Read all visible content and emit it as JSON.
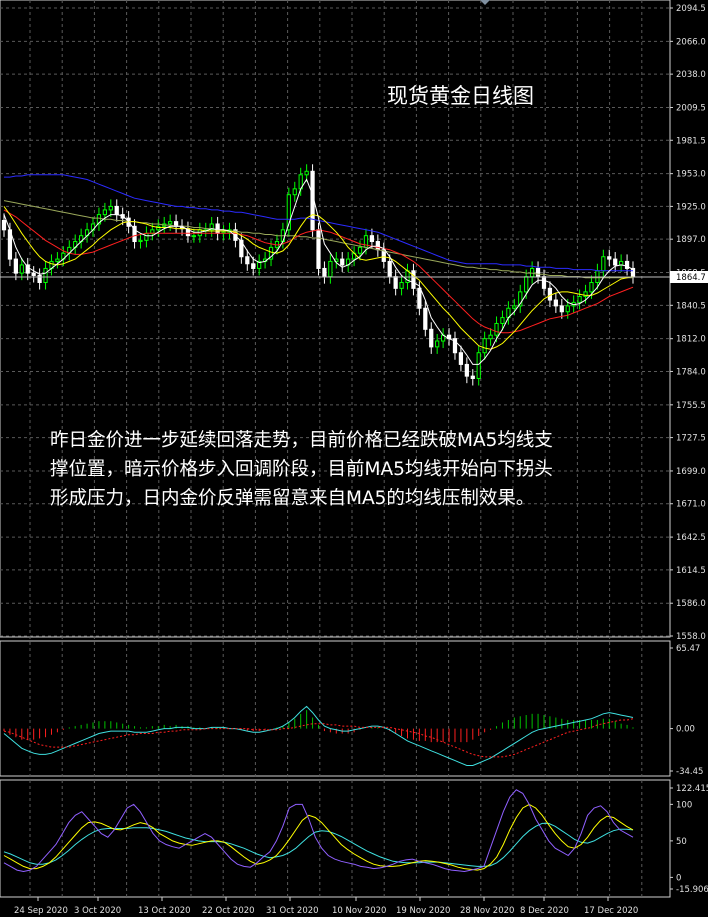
{
  "header": {
    "title": "现货黄金日线图"
  },
  "commentary": {
    "lines": [
      "昨日金价进一步延续回落走势，目前价格已经跌破MA5均线支",
      "撑位置，暗示价格步入回调阶段，目前MA5均线开始向下拐头",
      "形成压力，日内金价反弹需留意来自MA5的均线压制效果。"
    ]
  },
  "chart_data": [
    {
      "type": "candlestick",
      "panel": "price",
      "instrument": "现货黄金",
      "timeframe": "日线",
      "x_ticks": [
        "24 Sep 2020",
        "3 Oct 2020",
        "13 Oct 2020",
        "22 Oct 2020",
        "31 Oct 2020",
        "10 Nov 2020",
        "19 Nov 2020",
        "28 Nov 2020",
        "8 Dec 2020",
        "17 Dec 2020"
      ],
      "y_ticks": [
        2094.5,
        2066.0,
        2038.0,
        2009.5,
        1981.5,
        1953.0,
        1925.0,
        1897.0,
        1868.5,
        1840.5,
        1812.0,
        1784.0,
        1755.5,
        1727.5,
        1699.0,
        1671.0,
        1642.5,
        1614.5,
        1586.0,
        1558.0
      ],
      "current_price_label": "1864.7",
      "ylim": [
        1558.0,
        2094.5
      ],
      "grid": true,
      "colors": {
        "bull": "#00ff00",
        "bear": "#ffffff",
        "ma5": "#ffffff",
        "ma10": "#ffff00",
        "ma20": "#ff2020",
        "ma30": "#2b2bff",
        "ma60": "#9aa85a"
      },
      "close": [
        1905,
        1880,
        1868,
        1875,
        1868,
        1866,
        1860,
        1872,
        1878,
        1880,
        1885,
        1890,
        1895,
        1900,
        1905,
        1910,
        1918,
        1922,
        1925,
        1918,
        1915,
        1908,
        1895,
        1896,
        1902,
        1905,
        1908,
        1910,
        1912,
        1908,
        1906,
        1900,
        1900,
        1905,
        1905,
        1910,
        1902,
        1903,
        1905,
        1896,
        1882,
        1876,
        1872,
        1878,
        1880,
        1890,
        1895,
        1905,
        1935,
        1940,
        1952,
        1955,
        1905,
        1872,
        1865,
        1878,
        1880,
        1875,
        1880,
        1885,
        1890,
        1900,
        1895,
        1888,
        1878,
        1865,
        1855,
        1860,
        1870,
        1855,
        1838,
        1820,
        1805,
        1810,
        1815,
        1812,
        1800,
        1790,
        1780,
        1778,
        1800,
        1812,
        1815,
        1825,
        1830,
        1838,
        1840,
        1852,
        1865,
        1872,
        1865,
        1855,
        1845,
        1840,
        1835,
        1840,
        1843,
        1848,
        1852,
        1860,
        1870,
        1882,
        1880,
        1875,
        1878,
        1872,
        1865
      ],
      "ma5": [
        1918,
        1905,
        1890,
        1880,
        1873,
        1870,
        1867,
        1868,
        1872,
        1876,
        1880,
        1885,
        1890,
        1895,
        1900,
        1905,
        1911,
        1915,
        1918,
        1918,
        1917,
        1912,
        1905,
        1902,
        1900,
        1900,
        1903,
        1906,
        1908,
        1908,
        1908,
        1905,
        1903,
        1903,
        1904,
        1906,
        1905,
        1905,
        1904,
        1900,
        1895,
        1887,
        1880,
        1877,
        1878,
        1882,
        1887,
        1895,
        1910,
        1925,
        1940,
        1948,
        1935,
        1915,
        1893,
        1885,
        1877,
        1873,
        1875,
        1879,
        1882,
        1888,
        1891,
        1891,
        1889,
        1882,
        1873,
        1866,
        1862,
        1860,
        1857,
        1845,
        1830,
        1822,
        1815,
        1812,
        1810,
        1805,
        1798,
        1790,
        1790,
        1795,
        1802,
        1812,
        1820,
        1830,
        1835,
        1842,
        1850,
        1858,
        1862,
        1862,
        1860,
        1855,
        1848,
        1843,
        1841,
        1842,
        1845,
        1850,
        1856,
        1864,
        1870,
        1874,
        1875,
        1874,
        1871
      ],
      "ma10": [
        1925,
        1918,
        1910,
        1902,
        1895,
        1888,
        1882,
        1878,
        1876,
        1875,
        1876,
        1878,
        1880,
        1884,
        1888,
        1892,
        1897,
        1901,
        1905,
        1908,
        1911,
        1912,
        1912,
        1911,
        1910,
        1908,
        1907,
        1907,
        1907,
        1906,
        1906,
        1906,
        1905,
        1905,
        1904,
        1904,
        1904,
        1904,
        1904,
        1903,
        1900,
        1897,
        1893,
        1890,
        1888,
        1886,
        1885,
        1887,
        1892,
        1900,
        1908,
        1915,
        1918,
        1917,
        1913,
        1908,
        1903,
        1897,
        1890,
        1885,
        1880,
        1879,
        1880,
        1881,
        1882,
        1881,
        1878,
        1874,
        1870,
        1866,
        1862,
        1856,
        1850,
        1844,
        1838,
        1833,
        1827,
        1821,
        1816,
        1811,
        1806,
        1804,
        1803,
        1805,
        1808,
        1813,
        1818,
        1824,
        1830,
        1836,
        1841,
        1846,
        1849,
        1851,
        1852,
        1852,
        1851,
        1850,
        1849,
        1849,
        1851,
        1854,
        1857,
        1860,
        1863,
        1864,
        1865
      ],
      "ma20": [
        1922,
        1919,
        1916,
        1912,
        1908,
        1904,
        1900,
        1896,
        1893,
        1890,
        1887,
        1885,
        1884,
        1884,
        1885,
        1886,
        1888,
        1890,
        1892,
        1894,
        1896,
        1898,
        1900,
        1901,
        1902,
        1902,
        1902,
        1902,
        1902,
        1902,
        1902,
        1902,
        1902,
        1902,
        1902,
        1902,
        1902,
        1902,
        1902,
        1902,
        1901,
        1900,
        1898,
        1896,
        1894,
        1893,
        1892,
        1893,
        1895,
        1898,
        1901,
        1903,
        1904,
        1905,
        1904,
        1903,
        1901,
        1899,
        1897,
        1895,
        1893,
        1892,
        1891,
        1890,
        1889,
        1888,
        1886,
        1884,
        1881,
        1878,
        1874,
        1869,
        1864,
        1859,
        1854,
        1849,
        1844,
        1839,
        1834,
        1829,
        1825,
        1822,
        1820,
        1818,
        1817,
        1817,
        1818,
        1819,
        1821,
        1823,
        1825,
        1827,
        1829,
        1830,
        1831,
        1832,
        1834,
        1836,
        1838,
        1840,
        1842,
        1845,
        1848,
        1850,
        1852,
        1854,
        1856
      ],
      "ma30": [
        1950,
        1950,
        1951,
        1951,
        1952,
        1952,
        1952,
        1952,
        1952,
        1952,
        1952,
        1951,
        1950,
        1949,
        1948,
        1946,
        1944,
        1942,
        1940,
        1938,
        1936,
        1934,
        1932,
        1931,
        1930,
        1929,
        1928,
        1927,
        1926,
        1925,
        1925,
        1924,
        1924,
        1923,
        1923,
        1922,
        1922,
        1921,
        1921,
        1920,
        1920,
        1919,
        1918,
        1917,
        1916,
        1915,
        1914,
        1914,
        1914,
        1914,
        1915,
        1915,
        1914,
        1913,
        1912,
        1911,
        1910,
        1909,
        1908,
        1907,
        1906,
        1905,
        1904,
        1903,
        1901,
        1899,
        1897,
        1895,
        1893,
        1891,
        1889,
        1887,
        1885,
        1883,
        1881,
        1879,
        1878,
        1877,
        1876,
        1876,
        1876,
        1876,
        1876,
        1876,
        1875,
        1875,
        1875,
        1875,
        1874,
        1874,
        1873,
        1873,
        1873,
        1872,
        1872,
        1872,
        1871,
        1871,
        1871,
        1871,
        1870,
        1870,
        1870,
        1870,
        1870,
        1870,
        1870
      ],
      "ma60": [
        1930,
        1929,
        1928,
        1927,
        1926,
        1925,
        1924,
        1923,
        1922,
        1921,
        1920,
        1919,
        1918,
        1917,
        1916,
        1915,
        1915,
        1914,
        1914,
        1913,
        1913,
        1912,
        1912,
        1911,
        1911,
        1910,
        1910,
        1909,
        1909,
        1908,
        1908,
        1908,
        1907,
        1907,
        1906,
        1906,
        1905,
        1905,
        1904,
        1904,
        1903,
        1903,
        1902,
        1902,
        1901,
        1901,
        1900,
        1900,
        1900,
        1900,
        1899,
        1899,
        1898,
        1898,
        1897,
        1896,
        1895,
        1894,
        1893,
        1892,
        1891,
        1890,
        1889,
        1888,
        1887,
        1886,
        1885,
        1884,
        1883,
        1882,
        1881,
        1880,
        1879,
        1878,
        1877,
        1876,
        1875,
        1874,
        1873,
        1873,
        1872,
        1872,
        1871,
        1871,
        1870,
        1870,
        1869,
        1869,
        1868,
        1868,
        1867,
        1867,
        1866,
        1866,
        1866,
        1865,
        1865,
        1865,
        1864,
        1864,
        1864,
        1864,
        1864,
        1864,
        1864,
        1864,
        1864
      ]
    },
    {
      "type": "macd",
      "panel": "indicator-1",
      "y_ticks": [
        65.47,
        0.0,
        -34.45
      ],
      "ylim": [
        -34.45,
        65.47
      ],
      "colors": {
        "hist_pos": "#00c000",
        "hist_neg": "#ff2020",
        "macd": "#3fe0e0",
        "signal": "#ff2020"
      },
      "macd": [
        -4,
        -8,
        -12,
        -16,
        -18,
        -20,
        -21,
        -21,
        -20,
        -18,
        -16,
        -14,
        -12,
        -10,
        -8,
        -6,
        -4,
        -3,
        -2,
        -2,
        -2,
        -2,
        -3,
        -3,
        -3,
        -2,
        -1,
        0,
        0,
        1,
        1,
        1,
        0,
        0,
        0,
        1,
        1,
        1,
        0,
        0,
        -1,
        -2,
        -3,
        -3,
        -2,
        -1,
        0,
        2,
        5,
        9,
        14,
        18,
        13,
        7,
        2,
        0,
        -1,
        -2,
        -2,
        -1,
        0,
        1,
        2,
        2,
        1,
        -1,
        -4,
        -7,
        -10,
        -12,
        -14,
        -16,
        -18,
        -20,
        -22,
        -24,
        -26,
        -28,
        -30,
        -30,
        -28,
        -26,
        -24,
        -21,
        -18,
        -15,
        -12,
        -9,
        -6,
        -3,
        -1,
        0,
        1,
        2,
        3,
        4,
        5,
        6,
        7,
        8,
        10,
        12,
        13,
        12,
        11,
        10,
        9
      ],
      "signal": [
        -2,
        -3,
        -5,
        -7,
        -9,
        -11,
        -13,
        -14,
        -15,
        -15,
        -15,
        -15,
        -14,
        -13,
        -12,
        -11,
        -10,
        -9,
        -8,
        -7,
        -6,
        -5,
        -5,
        -4,
        -4,
        -4,
        -3,
        -3,
        -2,
        -2,
        -1,
        -1,
        -1,
        -1,
        0,
        0,
        0,
        0,
        0,
        0,
        0,
        0,
        -1,
        -1,
        -1,
        -1,
        -1,
        0,
        0,
        1,
        2,
        3,
        4,
        4,
        4,
        3,
        3,
        2,
        2,
        2,
        1,
        1,
        1,
        1,
        1,
        1,
        0,
        -1,
        -2,
        -3,
        -4,
        -6,
        -7,
        -9,
        -11,
        -13,
        -15,
        -17,
        -19,
        -21,
        -22,
        -23,
        -23,
        -23,
        -23,
        -22,
        -21,
        -19,
        -17,
        -15,
        -13,
        -11,
        -9,
        -7,
        -5,
        -3,
        -2,
        -1,
        0,
        1,
        3,
        4,
        5,
        6,
        7,
        7,
        8
      ]
    },
    {
      "type": "stochastic",
      "panel": "indicator-2",
      "y_ticks": [
        122.415,
        100,
        50,
        0.0,
        -15.906
      ],
      "ylim": [
        -15.906,
        122.415
      ],
      "colors": {
        "k": "#9060ff",
        "d": "#ffff00",
        "slow": "#3fe0e0"
      },
      "k": [
        20,
        15,
        10,
        8,
        10,
        15,
        25,
        35,
        45,
        60,
        75,
        85,
        90,
        80,
        70,
        60,
        55,
        65,
        80,
        95,
        100,
        90,
        75,
        60,
        50,
        45,
        42,
        40,
        45,
        50,
        55,
        60,
        55,
        45,
        35,
        25,
        18,
        15,
        14,
        20,
        28,
        35,
        50,
        70,
        95,
        100,
        100,
        80,
        55,
        40,
        30,
        25,
        22,
        20,
        18,
        15,
        14,
        12,
        13,
        15,
        18,
        22,
        24,
        25,
        22,
        20,
        18,
        15,
        12,
        10,
        9,
        8,
        10,
        12,
        15,
        40,
        65,
        90,
        110,
        120,
        115,
        100,
        80,
        65,
        50,
        40,
        35,
        30,
        40,
        60,
        85,
        95,
        98,
        90,
        75,
        65,
        60,
        55
      ],
      "d": [
        30,
        25,
        20,
        15,
        12,
        12,
        15,
        20,
        28,
        38,
        48,
        58,
        68,
        75,
        76,
        74,
        70,
        66,
        65,
        68,
        72,
        75,
        73,
        68,
        60,
        55,
        50,
        47,
        45,
        44,
        46,
        48,
        50,
        50,
        48,
        42,
        35,
        28,
        22,
        18,
        20,
        24,
        30,
        40,
        52,
        65,
        78,
        85,
        82,
        75,
        65,
        55,
        45,
        38,
        32,
        27,
        22,
        18,
        16,
        15,
        15,
        16,
        18,
        20,
        22,
        23,
        22,
        21,
        19,
        17,
        14,
        12,
        11,
        10,
        12,
        18,
        28,
        45,
        65,
        82,
        95,
        100,
        95,
        85,
        72,
        60,
        50,
        42,
        40,
        45,
        55,
        68,
        78,
        84,
        82,
        76,
        70,
        65
      ],
      "slow": [
        35,
        32,
        28,
        24,
        20,
        18,
        18,
        20,
        24,
        30,
        37,
        45,
        52,
        58,
        63,
        66,
        67,
        67,
        67,
        67,
        68,
        68,
        68,
        67,
        65,
        63,
        60,
        57,
        54,
        52,
        50,
        49,
        49,
        49,
        48,
        46,
        43,
        40,
        36,
        32,
        29,
        27,
        28,
        30,
        34,
        40,
        48,
        56,
        62,
        64,
        63,
        60,
        56,
        51,
        46,
        41,
        36,
        32,
        28,
        25,
        22,
        21,
        20,
        20,
        20,
        21,
        21,
        21,
        20,
        19,
        18,
        17,
        16,
        15,
        15,
        16,
        20,
        27,
        36,
        46,
        56,
        64,
        70,
        74,
        74,
        70,
        64,
        58,
        52,
        48,
        47,
        50,
        55,
        60,
        64,
        66,
        66,
        65
      ]
    }
  ]
}
